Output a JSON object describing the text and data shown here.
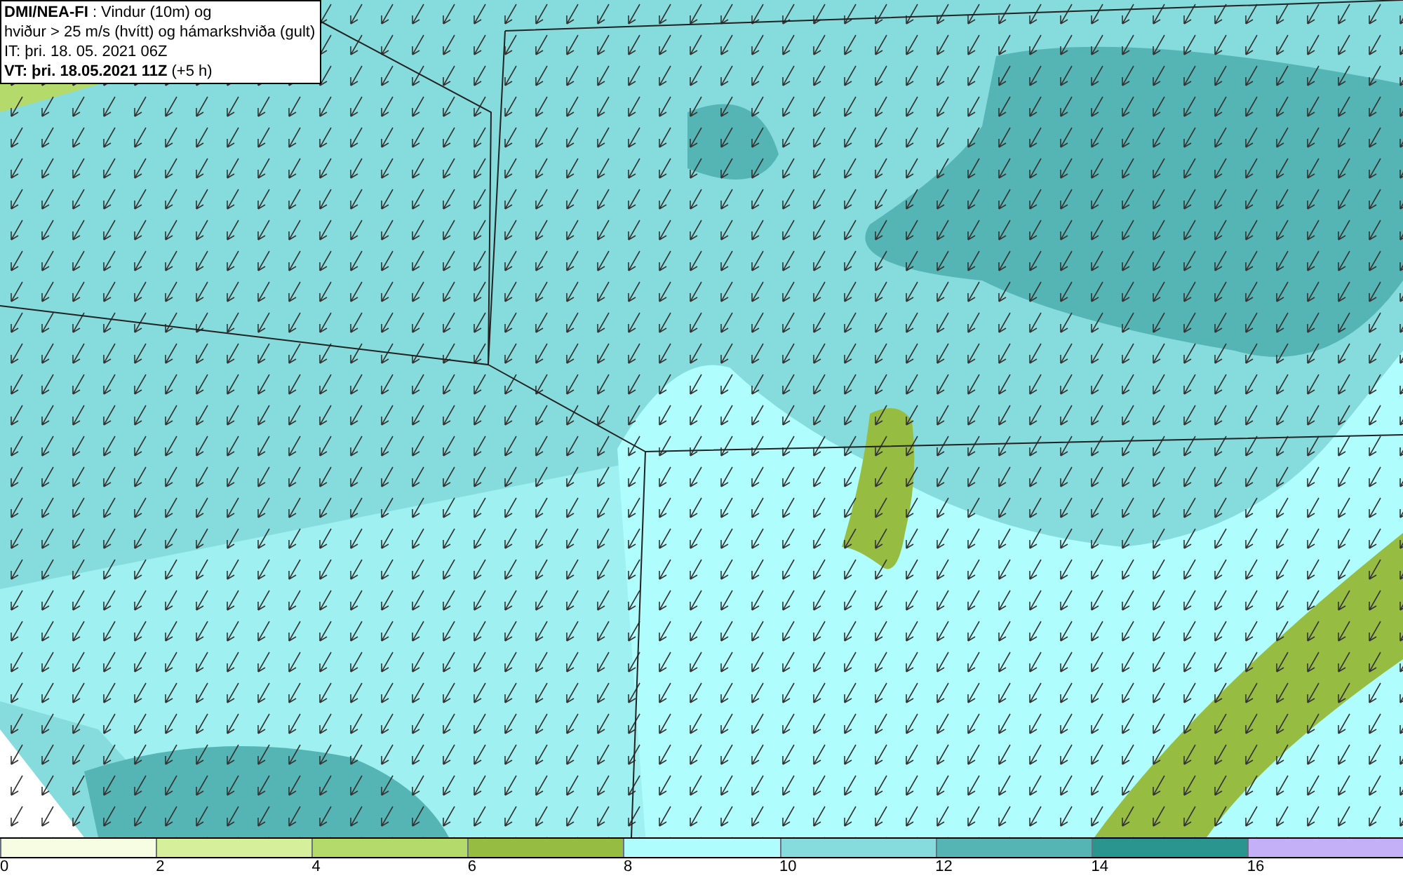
{
  "title_box": {
    "lines": [
      "**DMI/NEA-FI** : Vindur (10m) og",
      "hviður > 25 m/s (hvítt) og hámarkshviða (gult)",
      "IT: þri. 18. 05. 2021 06Z",
      "**VT: þri. 18.05.2021 11Z** (+5 h)"
    ]
  },
  "legend": {
    "bins": [
      {
        "color": "#f6fde3"
      },
      {
        "color": "#d6ef9a"
      },
      {
        "color": "#b4da6c"
      },
      {
        "color": "#96bd42"
      },
      {
        "color": "#b0fdfe"
      },
      {
        "color": "#86dcdc"
      },
      {
        "color": "#55b5b5"
      },
      {
        "color": "#2a958f"
      },
      {
        "color": "#c4b0f7"
      }
    ],
    "ticks": [
      "0",
      "2",
      "4",
      "6",
      "8",
      "10",
      "12",
      "14",
      "16"
    ]
  }
}
